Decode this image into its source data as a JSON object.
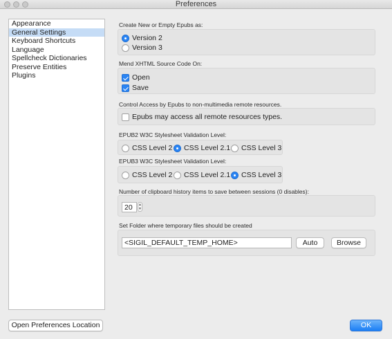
{
  "window": {
    "title": "Preferences"
  },
  "sidebar": {
    "items": [
      {
        "label": "Appearance",
        "selected": false
      },
      {
        "label": "General Settings",
        "selected": true
      },
      {
        "label": "Keyboard Shortcuts",
        "selected": false
      },
      {
        "label": "Language",
        "selected": false
      },
      {
        "label": "Spellcheck Dictionaries",
        "selected": false
      },
      {
        "label": "Preserve Entities",
        "selected": false
      },
      {
        "label": "Plugins",
        "selected": false
      }
    ]
  },
  "epub_version": {
    "heading": "Create New or Empty Epubs as:",
    "options": [
      "Version 2",
      "Version 3"
    ],
    "selected": "Version 2"
  },
  "mend": {
    "heading": "Mend XHTML Source Code On:",
    "open_label": "Open",
    "open_checked": true,
    "save_label": "Save",
    "save_checked": true
  },
  "remote": {
    "heading": "Control Access by Epubs to non-multimedia remote resources.",
    "checkbox_label": "Epubs may access all remote resources types.",
    "checked": false
  },
  "epub2_css": {
    "heading": "EPUB2 W3C Stylesheet Validation Level:",
    "options": [
      "CSS Level 2",
      "CSS Level 2.1",
      "CSS Level 3"
    ],
    "selected": "CSS Level 2.1"
  },
  "epub3_css": {
    "heading": "EPUB3 W3C Stylesheet Validation Level:",
    "options": [
      "CSS Level 2",
      "CSS Level 2.1",
      "CSS Level 3"
    ],
    "selected": "CSS Level 3"
  },
  "clipboard": {
    "heading": "Number of clipboard history items to save between sessions (0 disables):",
    "value": "20"
  },
  "temp_folder": {
    "heading": "Set Folder where temporary files should be created",
    "value": "<SIGIL_DEFAULT_TEMP_HOME>",
    "auto_label": "Auto",
    "browse_label": "Browse"
  },
  "footer": {
    "open_prefs_label": "Open Preferences Location",
    "ok_label": "OK"
  },
  "colors": {
    "accent": "#2a84f3",
    "selection": "#c5dcf6",
    "window_bg": "#ececec"
  }
}
